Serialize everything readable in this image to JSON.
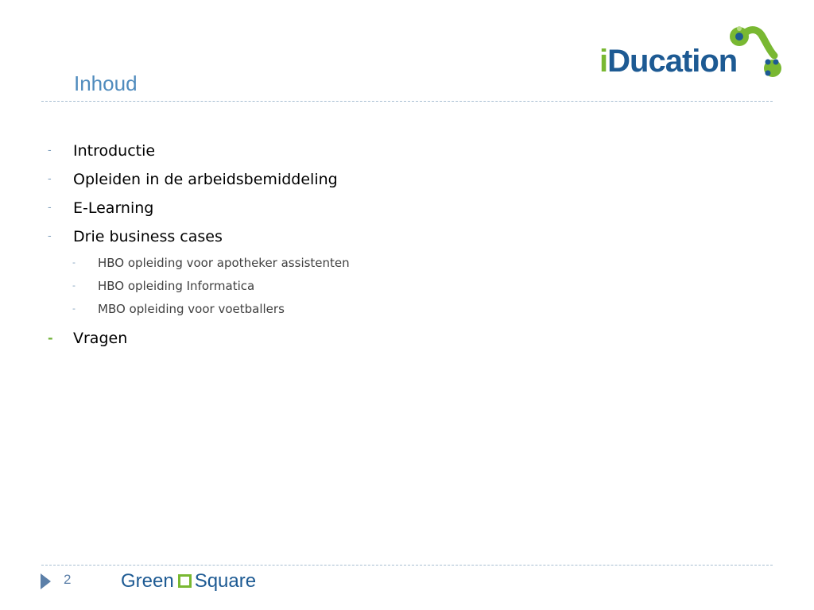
{
  "slide": {
    "title": "Inhoud",
    "page_number": "2"
  },
  "logo_top": {
    "letter_i": "i",
    "rest": "Ducation",
    "colors": {
      "green": "#79b832",
      "blue": "#1d5a93"
    }
  },
  "logo_bottom": {
    "left": "Green",
    "right": "Square",
    "colors": {
      "square": "#79b832",
      "text": "#1d5a93"
    }
  },
  "items": [
    {
      "text": "Introductie"
    },
    {
      "text": "Opleiden in de arbeidsbemiddeling"
    },
    {
      "text": "E-Learning"
    },
    {
      "text": "Drie business cases"
    },
    {
      "text": "HBO opleiding voor apotheker assistenten"
    },
    {
      "text": "HBO opleiding Informatica"
    },
    {
      "text": "MBO opleiding voor voetballers"
    },
    {
      "text": "Vragen"
    }
  ],
  "bullet": "-",
  "colors": {
    "title": "#4f8bbd",
    "bullet": "#7f9fbd",
    "bullet_highlight": "#6fb136",
    "divider": "#a8bed2"
  }
}
